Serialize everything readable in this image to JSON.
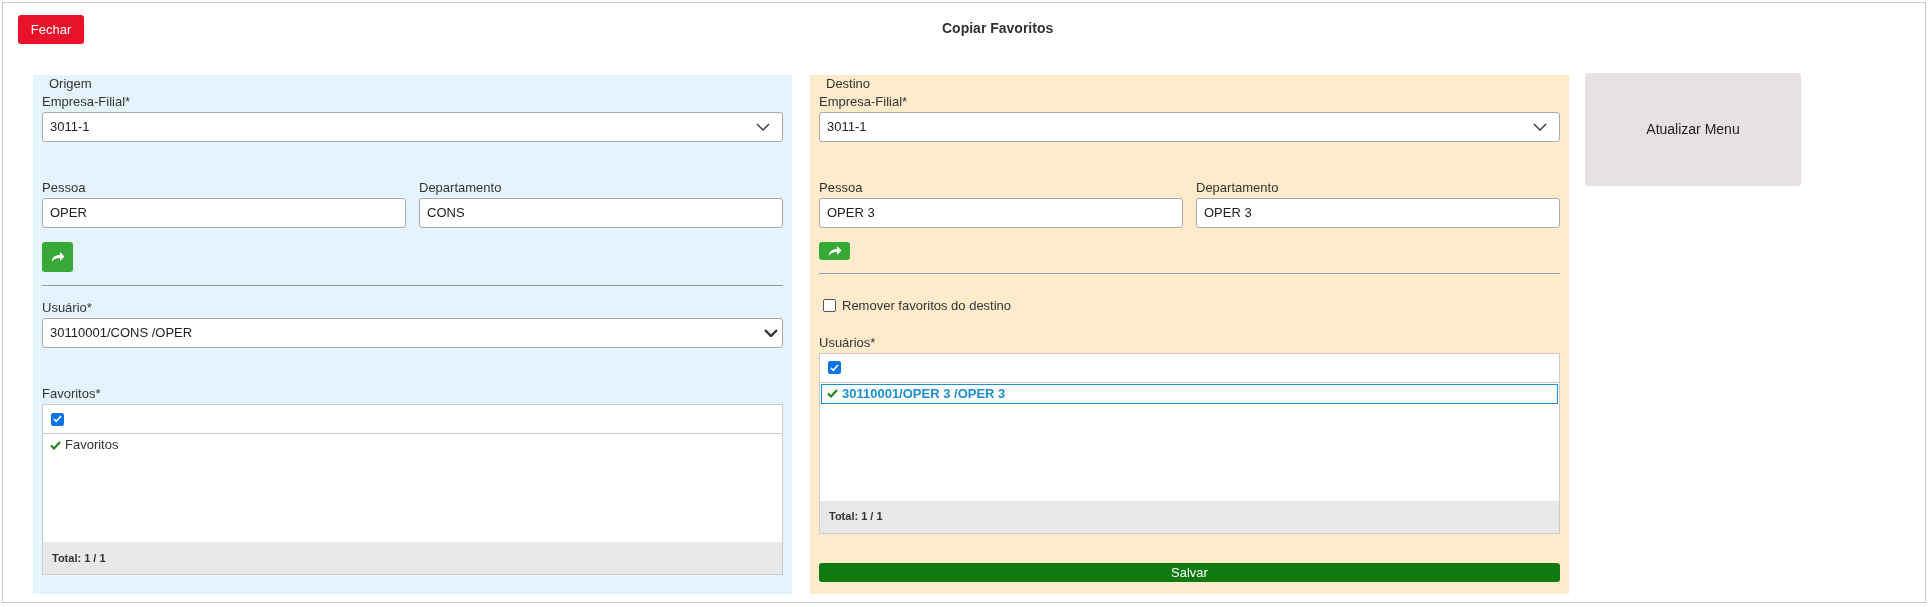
{
  "close_button": "Fechar",
  "title": "Copiar Favoritos",
  "origin": {
    "legend": "Origem",
    "company": {
      "label": "Empresa-Filial*",
      "value": "3011-1"
    },
    "person": {
      "label": "Pessoa",
      "value": "OPER"
    },
    "department": {
      "label": "Departamento",
      "value": "CONS"
    },
    "user": {
      "label": "Usuário*",
      "value": "30110001/CONS /OPER"
    },
    "favorites": {
      "label": "Favoritos*",
      "select_all_checked": true,
      "items": [
        {
          "label": "Favoritos",
          "checked": true,
          "selected": false
        }
      ],
      "total": "Total: 1 / 1"
    }
  },
  "destination": {
    "legend": "Destino",
    "company": {
      "label": "Empresa-Filial*",
      "value": "3011-1"
    },
    "person": {
      "label": "Pessoa",
      "value": "OPER 3"
    },
    "department": {
      "label": "Departamento",
      "value": "OPER 3"
    },
    "remove_favorites": {
      "label": "Remover favoritos do destino",
      "checked": false
    },
    "users": {
      "label": "Usuários*",
      "select_all_checked": true,
      "items": [
        {
          "label": "30110001/OPER 3 /OPER 3",
          "checked": true,
          "selected": true
        }
      ],
      "total": "Total: 1 / 1"
    },
    "save_button": "Salvar"
  },
  "refresh_button": "Atualizar Menu"
}
